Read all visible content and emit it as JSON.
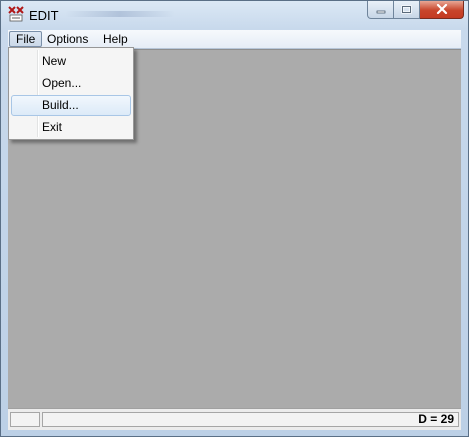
{
  "window": {
    "title": "EDIT",
    "app_icon": "application-icon",
    "caption_buttons": [
      "minimize-icon",
      "maximize-icon",
      "close-icon"
    ]
  },
  "menubar": {
    "items": [
      {
        "label": "File",
        "open": true
      },
      {
        "label": "Options",
        "open": false
      },
      {
        "label": "Help",
        "open": false
      }
    ]
  },
  "file_menu": {
    "items": [
      {
        "label": "New"
      },
      {
        "label": "Open..."
      },
      {
        "label": "Build...",
        "highlighted": true
      },
      {
        "label": "Exit"
      }
    ]
  },
  "statusbar": {
    "text": "D = 29"
  },
  "colors": {
    "client_background": "#ababab",
    "close_button": "#c8452b"
  }
}
